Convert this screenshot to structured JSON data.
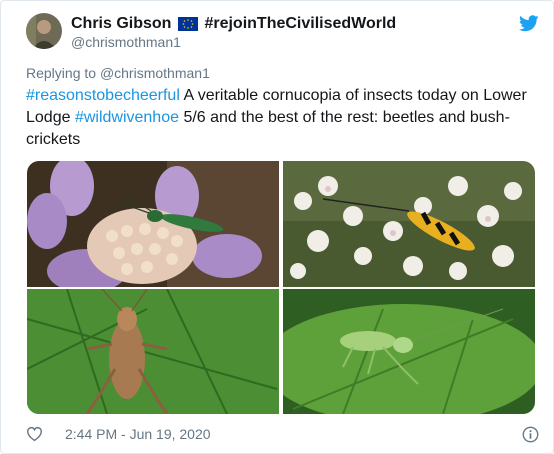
{
  "tweet": {
    "display_name": "Chris Gibson",
    "hashtag_name": "#rejoinTheCivilisedWorld",
    "handle": "@chrismothman1",
    "replying_prefix": "Replying to ",
    "replying_to": "@chrismothman1",
    "text_parts": {
      "tag1": "#reasonstobecheerful",
      "part1": " A veritable cornucopia of insects today on Lower Lodge ",
      "tag2": "#wildwivenhoe",
      "part2": " 5/6 and the best of the rest: beetles and bush-crickets"
    },
    "timestamp": "2:44 PM - Jun 19, 2020"
  },
  "icons": {
    "flag": "eu-flag-icon",
    "logo": "twitter-bird-icon",
    "like": "heart-icon",
    "info": "info-icon"
  },
  "colors": {
    "link": "#1b95e0",
    "twitter_blue": "#1da1f2",
    "muted": "#657786",
    "eu_blue": "#003399",
    "eu_gold": "#ffcc00"
  }
}
